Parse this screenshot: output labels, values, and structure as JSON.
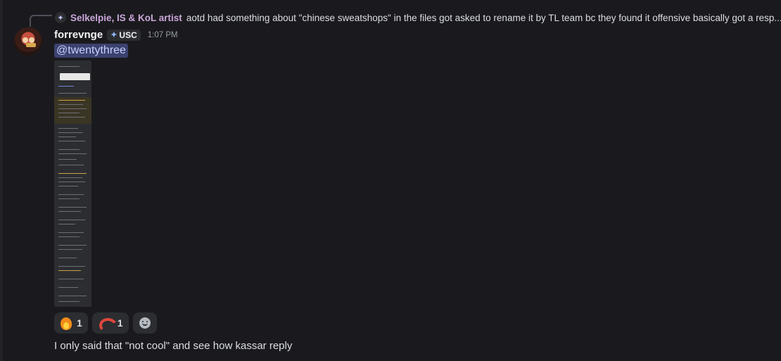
{
  "reply": {
    "author": "Selkelpie, IS & KoL artist",
    "text": "aotd had something about \"chinese sweatshops\" in the files got asked to rename it by TL team bc they found it offensive basically got a resp..."
  },
  "message": {
    "username": "forrevnge",
    "tag": "USC",
    "timestamp": "1:07 PM",
    "mention": "@twentythree"
  },
  "attachment": {
    "type": "image",
    "icon_name": "screenshot-thumbnail"
  },
  "reactions": [
    {
      "emoji": "fire",
      "count": "1"
    },
    {
      "emoji": "shrimp",
      "count": "1"
    }
  ],
  "next_message": {
    "text": "I only said that \"not cool\" and see how kassar reply"
  },
  "colors": {
    "mention_bg": "#3c4270",
    "reply_author": "#c9a7d9",
    "background": "#1a1a1e"
  }
}
